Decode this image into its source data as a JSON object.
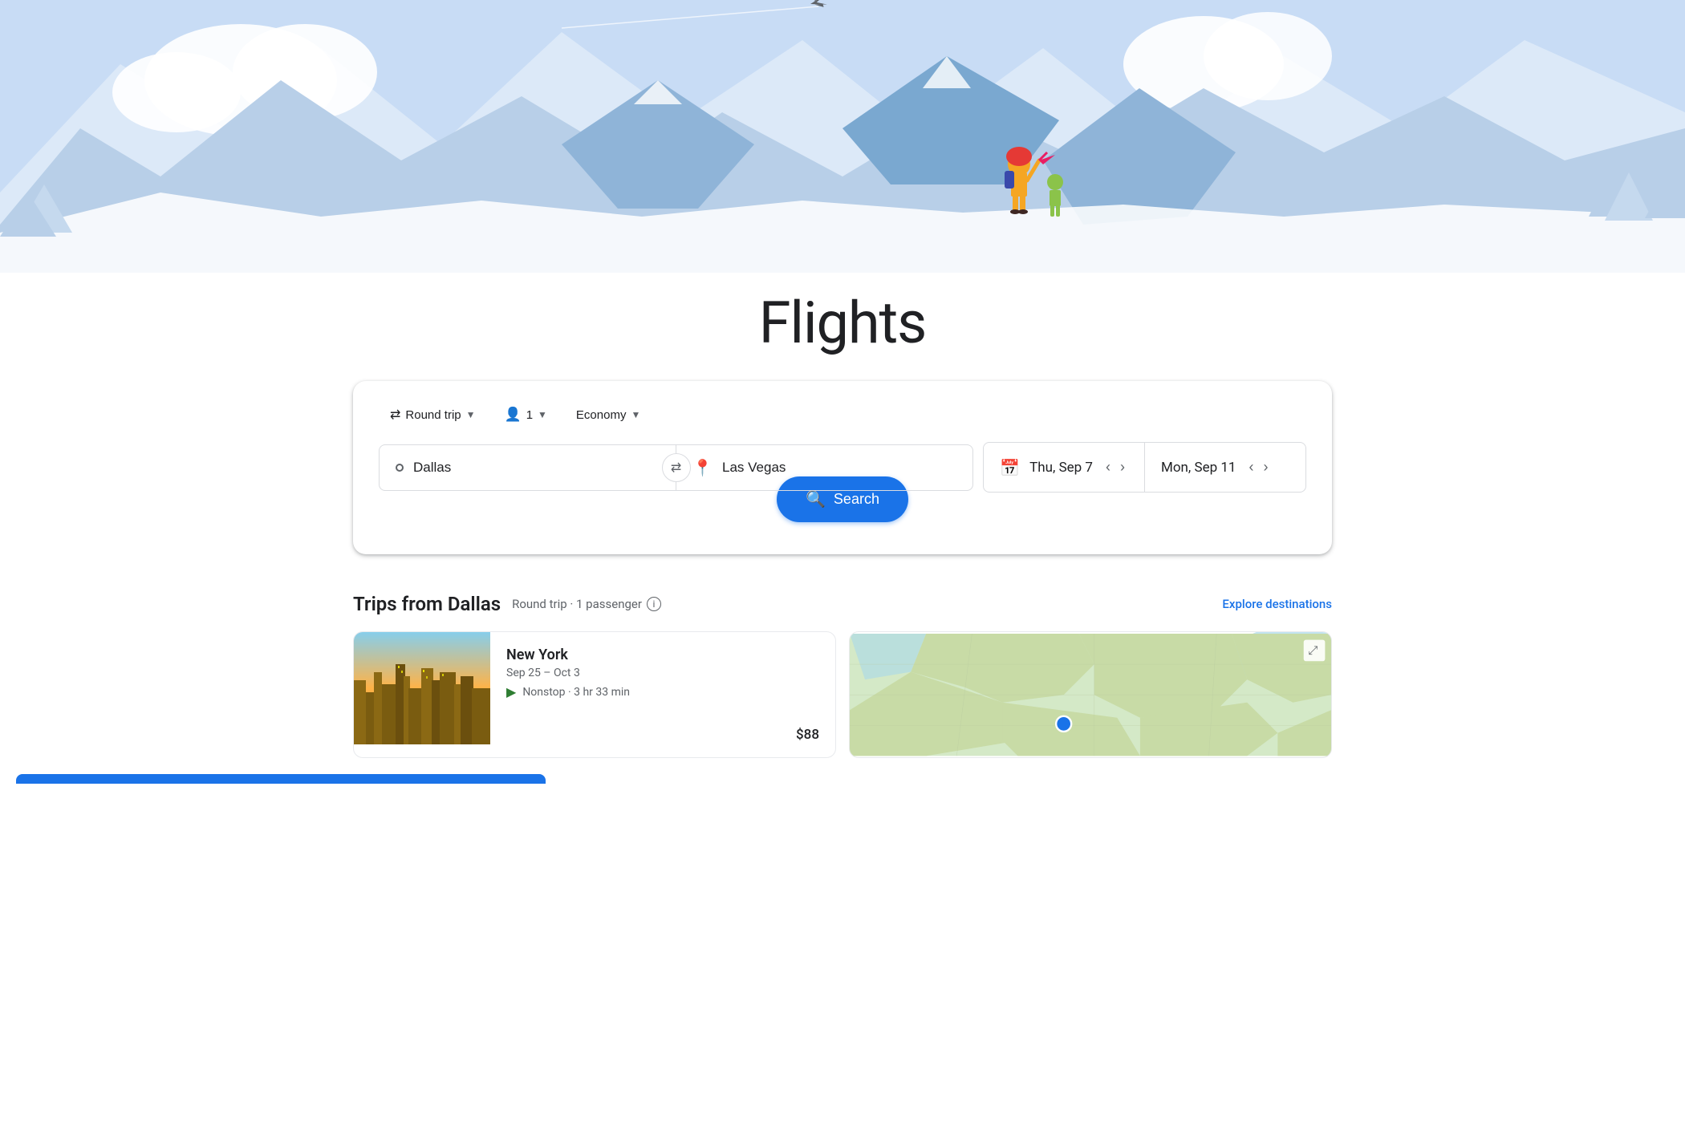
{
  "page": {
    "title": "Flights"
  },
  "hero": {
    "alt": "Travel illustration with mountains and figures"
  },
  "search": {
    "trip_type": {
      "label": "Round trip",
      "chevron": "▼"
    },
    "passengers": {
      "count": "1",
      "icon": "person",
      "chevron": "▼"
    },
    "cabin": {
      "label": "Economy",
      "chevron": "▼"
    },
    "origin": {
      "placeholder": "Dallas",
      "value": "Dallas"
    },
    "destination": {
      "placeholder": "Las Vegas",
      "value": "Las Vegas"
    },
    "depart": {
      "label": "Thu, Sep 7"
    },
    "return": {
      "label": "Mon, Sep 11"
    },
    "search_btn": "Search"
  },
  "trips": {
    "heading": "Trips from Dallas",
    "subtext": "Round trip · 1 passenger",
    "explore_label": "Explore destinations",
    "cards": [
      {
        "city": "New York",
        "dates": "Sep 25 – Oct 3",
        "flight_info": "Nonstop · 3 hr 33 min",
        "price": "$88"
      }
    ]
  }
}
